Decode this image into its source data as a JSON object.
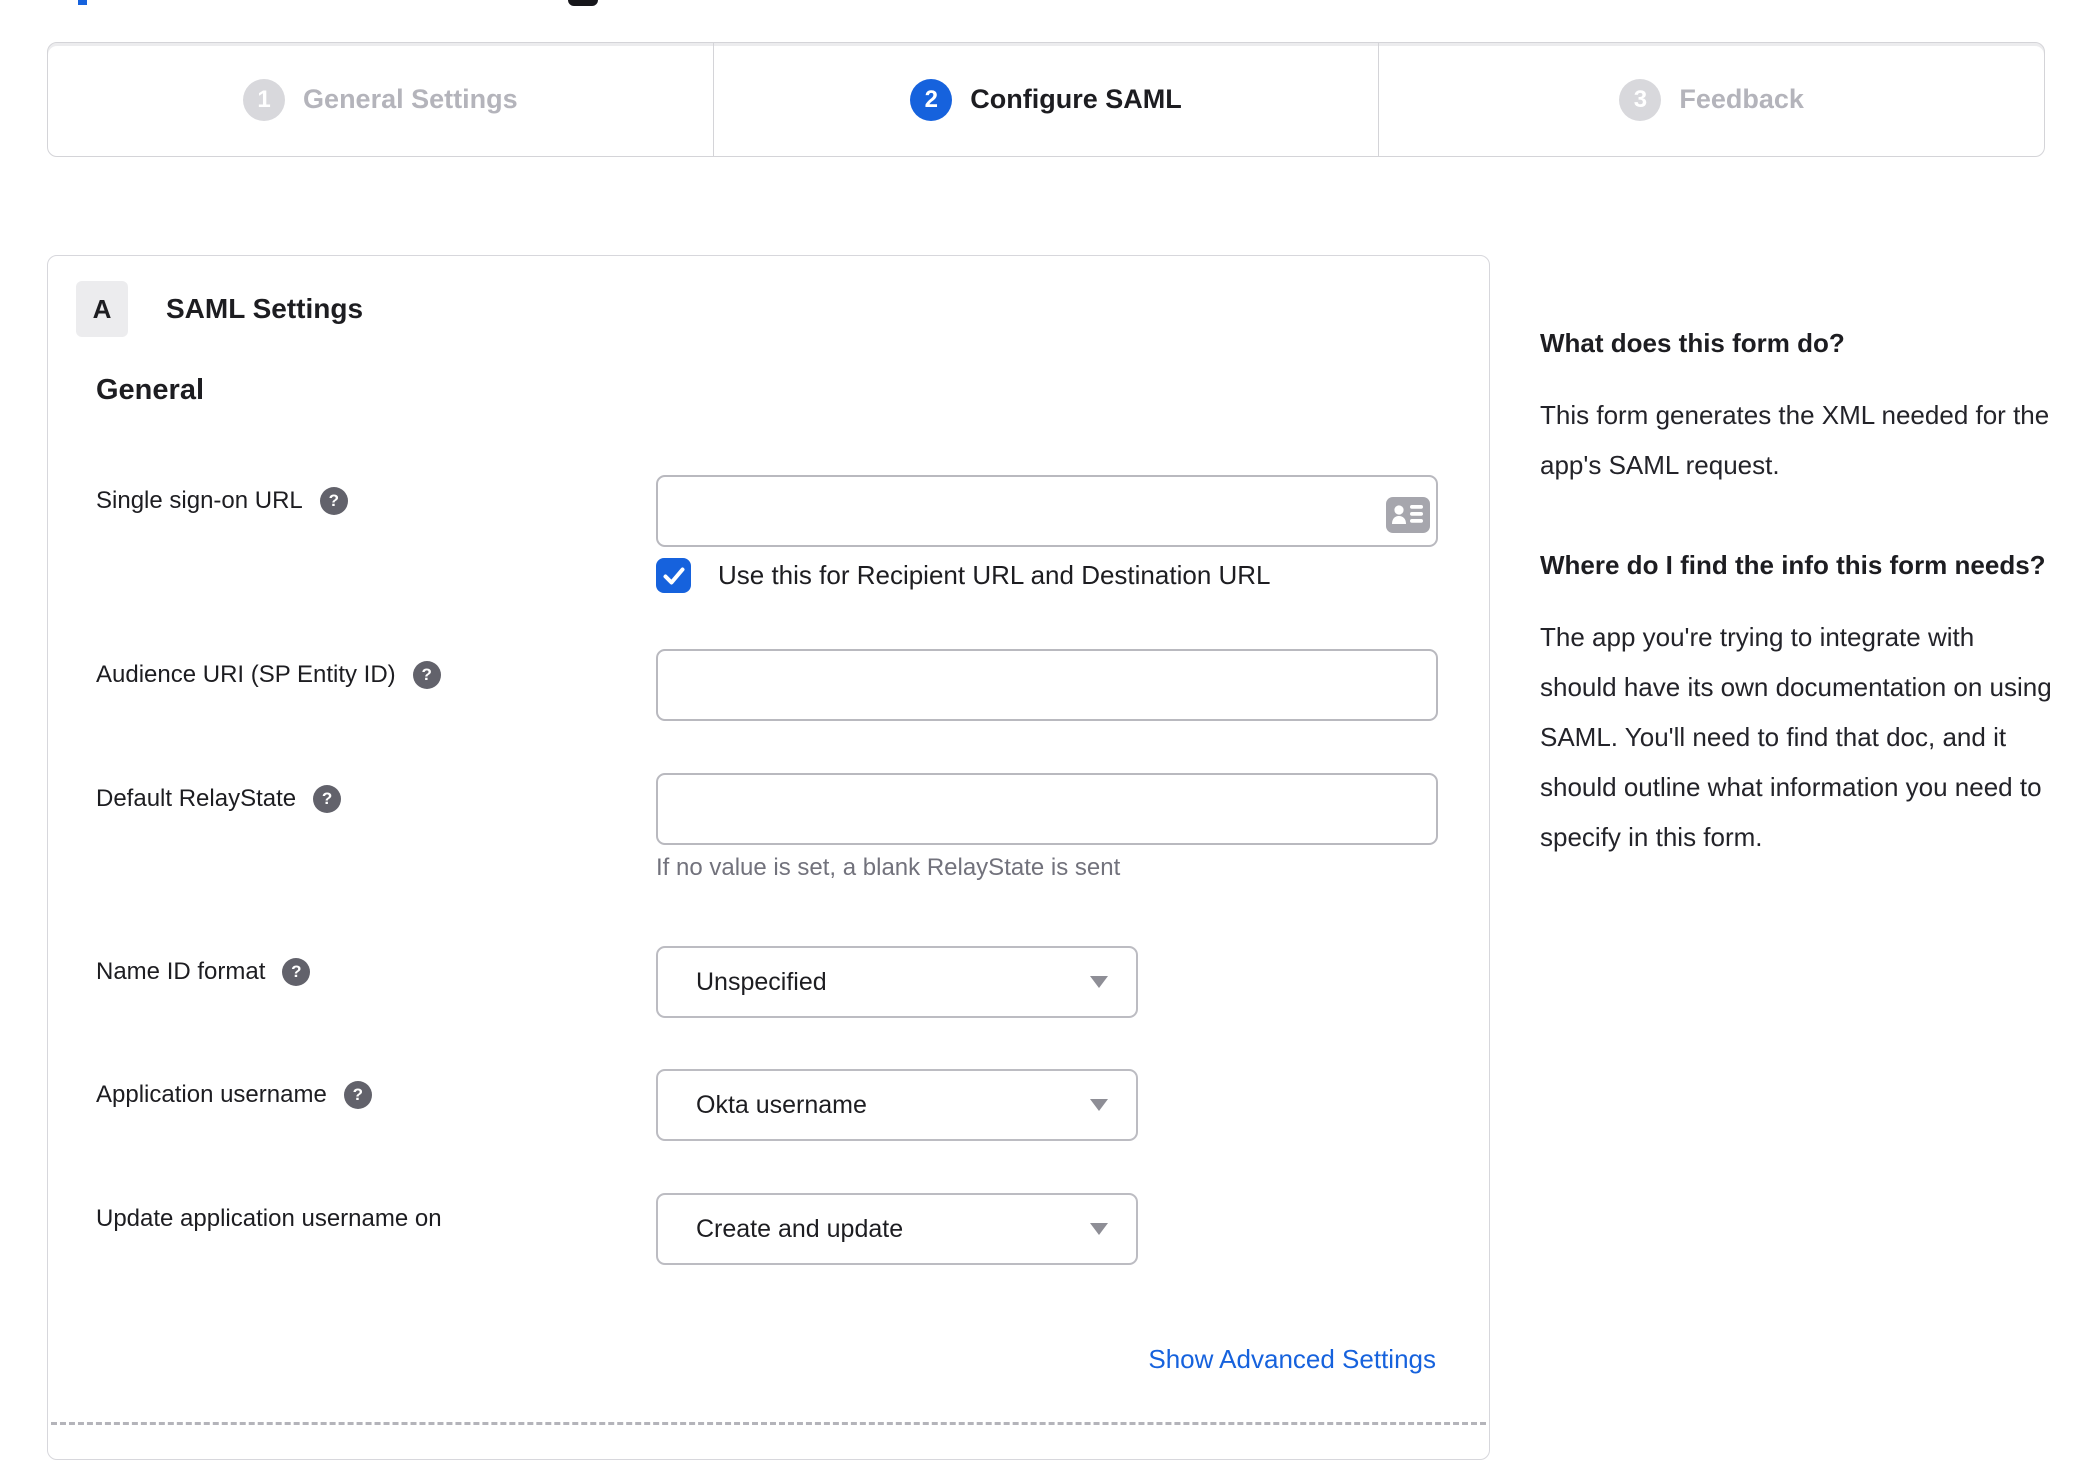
{
  "stepper": {
    "steps": [
      {
        "number": "1",
        "label": "General Settings",
        "state": "completed"
      },
      {
        "number": "2",
        "label": "Configure SAML",
        "state": "active"
      },
      {
        "number": "3",
        "label": "Feedback",
        "state": "upcoming"
      }
    ]
  },
  "panel": {
    "badge_label": "A",
    "title": "SAML Settings",
    "section_heading": "General"
  },
  "form": {
    "sso": {
      "label": "Single sign-on URL",
      "value": "",
      "checkbox_checked": true,
      "checkbox_label": "Use this for Recipient URL and Destination URL"
    },
    "audience": {
      "label": "Audience URI (SP Entity ID)",
      "value": ""
    },
    "relay_state": {
      "label": "Default RelayState",
      "value": "",
      "hint": "If no value is set, a blank RelayState is sent"
    },
    "name_id_format": {
      "label": "Name ID format",
      "value": "Unspecified"
    },
    "application_username": {
      "label": "Application username",
      "value": "Okta username"
    },
    "update_application_username_on": {
      "label": "Update application username on",
      "value": "Create and update"
    },
    "advanced_link_label": "Show Advanced Settings"
  },
  "help": {
    "q1": "What does this form do?",
    "a1": "This form generates the XML needed for the app's SAML request.",
    "q2": "Where do I find the info this form needs?",
    "a2": "The app you're trying to integrate with should have its own documentation on using SAML. You'll need to find that doc, and it should outline what information you need to specify in this form."
  },
  "icons": {
    "question_glyph": "?",
    "help_icon": "question-mark-icon",
    "input_icon": "contact-card-icon",
    "select_icon": "chevron-down-icon",
    "checkbox_icon": "checkmark-icon"
  },
  "colors": {
    "accent_blue": "#1662dd",
    "text_dark": "#1d1d21",
    "inactive_gray": "#b4b4bb",
    "step_circle_gray": "#d8d8dc",
    "input_border_gray": "#b9b9bf",
    "help_icon_gray": "#62626b",
    "hint_gray": "#72727c"
  }
}
